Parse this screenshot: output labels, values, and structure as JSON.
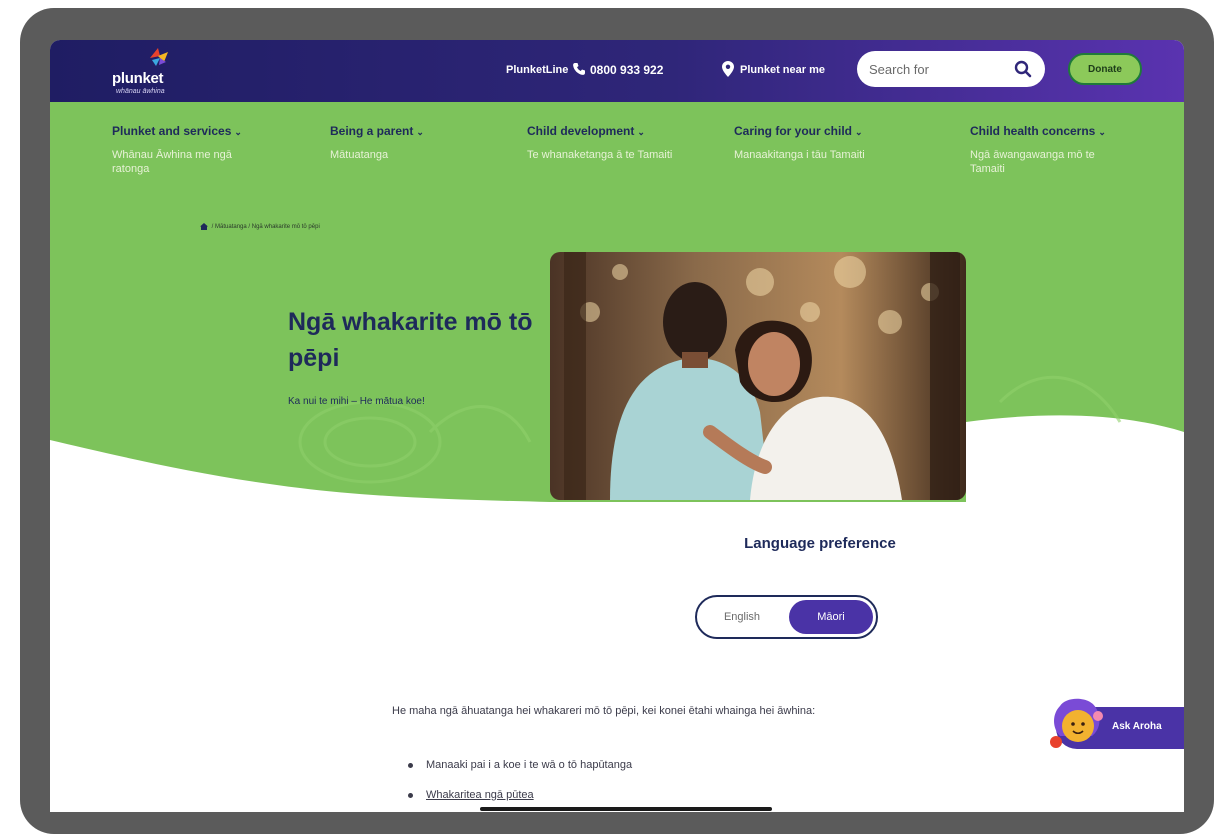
{
  "header": {
    "logo_text": "plunket",
    "logo_sub": "whānau āwhina",
    "plunketline_label": "PlunketLine",
    "phone_number": "0800 933 922",
    "near_me_label": "Plunket near me",
    "search_placeholder": "Search for",
    "donate_label": "Donate"
  },
  "nav": [
    {
      "title": "Plunket and services",
      "subtitle": "Whānau Āwhina me ngā ratonga"
    },
    {
      "title": "Being a parent",
      "subtitle": "Mātuatanga"
    },
    {
      "title": "Child development",
      "subtitle": "Te whanaketanga ā te Tamaiti"
    },
    {
      "title": "Caring for your child",
      "subtitle": "Manaakitanga i tāu Tamaiti"
    },
    {
      "title": "Child health concerns",
      "subtitle": "Ngā āwangawanga mō te Tamaiti"
    }
  ],
  "breadcrumb": {
    "parent": "Mātuatanga",
    "current": "Ngā whakarite mō tō pēpi"
  },
  "hero": {
    "title": "Ngā whakarite mō tō pēpi",
    "subtitle": "Ka nui te mihi – He mātua koe!"
  },
  "language": {
    "title": "Language preference",
    "english": "English",
    "maori": "Māori",
    "selected": "Māori"
  },
  "content": {
    "intro": "He maha ngā āhuatanga hei whakareri mō tō pēpi, kei konei ētahi whainga hei āwhina:",
    "items": [
      "Manaaki pai i a koe i te wā o tō hapūtanga",
      "Whakaritea ngā pūtea"
    ]
  },
  "assistant": {
    "label": "Ask Aroha"
  },
  "colors": {
    "navy": "#1e2a5a",
    "purple": "#4a33a6",
    "green": "#7dc35b"
  }
}
